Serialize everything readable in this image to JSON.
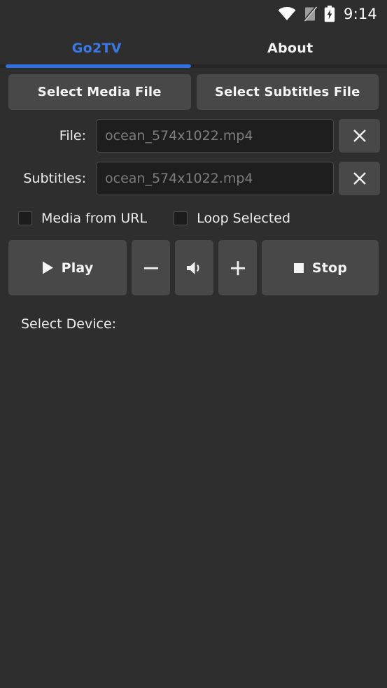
{
  "statusbar": {
    "wifi_icon": "wifi-icon",
    "signal_off_icon": "signal-off-icon",
    "battery_charging_icon": "battery-charging-icon",
    "time": "9:14"
  },
  "tabs": [
    {
      "label": "Go2TV",
      "active": true
    },
    {
      "label": "About",
      "active": false
    }
  ],
  "theme": {
    "background": "#2e2e2e",
    "accent": "#3b78e7",
    "indicator": "#2f6fe4",
    "button_bg": "#484848",
    "input_bg": "#1e1e1e",
    "text": "#ededed",
    "placeholder": "#7d7d7d"
  },
  "actions": {
    "select_media_file": "Select Media File",
    "select_subtitles_file": "Select Subtitles File"
  },
  "fields": {
    "file": {
      "label": "File:",
      "value": "",
      "placeholder": "ocean_574x1022.mp4",
      "clear_icon": "close-icon"
    },
    "subtitles": {
      "label": "Subtitles:",
      "value": "",
      "placeholder": "ocean_574x1022.mp4",
      "clear_icon": "close-icon"
    }
  },
  "checkboxes": [
    {
      "label": "Media from URL",
      "checked": false
    },
    {
      "label": "Loop Selected",
      "checked": false
    }
  ],
  "controls": {
    "play": {
      "label": "Play",
      "icon": "play-icon"
    },
    "volume_down": {
      "label": "",
      "icon": "minus-icon"
    },
    "volume": {
      "label": "",
      "icon": "speaker-icon"
    },
    "volume_up": {
      "label": "",
      "icon": "plus-icon"
    },
    "stop": {
      "label": "Stop",
      "icon": "stop-icon"
    }
  },
  "device": {
    "label": "Select Device:"
  }
}
